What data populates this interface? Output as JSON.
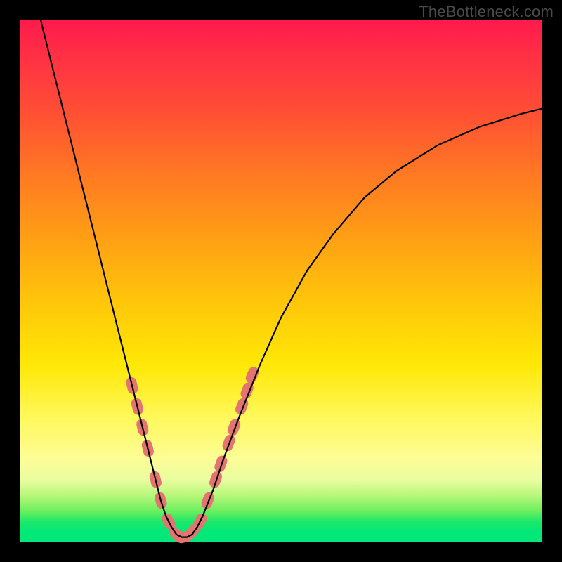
{
  "watermark": "TheBottleneck.com",
  "colors": {
    "frame": "#000000",
    "curve": "#000000",
    "bead": "#e4746f",
    "gradient_stops": [
      "#ff1a4d",
      "#ff3044",
      "#ff5034",
      "#ff7a22",
      "#ffa014",
      "#ffc60a",
      "#ffe805",
      "#fff85a",
      "#fdfd96",
      "#eafda0",
      "#b8f77a",
      "#6cef5e",
      "#1fe86a",
      "#00e878"
    ]
  },
  "chart_data": {
    "type": "line",
    "title": "",
    "xlabel": "",
    "ylabel": "",
    "xlim": [
      0,
      100
    ],
    "ylim": [
      0,
      100
    ],
    "series": [
      {
        "name": "bottleneck-curve",
        "x": [
          4,
          6,
          8,
          10,
          12,
          14,
          16,
          18,
          20,
          22,
          24,
          26,
          27,
          28,
          29,
          30,
          31,
          32,
          33,
          34,
          35,
          37,
          39,
          42,
          46,
          50,
          55,
          60,
          66,
          72,
          80,
          88,
          96,
          100
        ],
        "y": [
          100,
          92,
          84,
          76,
          68,
          60,
          52,
          44,
          36,
          28,
          20,
          12,
          8,
          5,
          3,
          1.5,
          1,
          1,
          1.5,
          3,
          5,
          10,
          16,
          24,
          34,
          43,
          52,
          59,
          66,
          71,
          76,
          79.5,
          82,
          83
        ]
      }
    ],
    "beads": {
      "comment": "Pink rounded segments overlaid on the curve near the valley",
      "points_xy": [
        [
          21.5,
          30
        ],
        [
          22.5,
          26
        ],
        [
          23.5,
          22
        ],
        [
          24.5,
          18
        ],
        [
          26,
          12
        ],
        [
          27,
          8
        ],
        [
          28.5,
          4
        ],
        [
          30,
          1.5
        ],
        [
          31.5,
          1
        ],
        [
          33,
          2
        ],
        [
          34.5,
          4
        ],
        [
          36,
          8
        ],
        [
          37.5,
          12
        ],
        [
          38.5,
          15
        ],
        [
          40,
          19
        ],
        [
          41,
          22
        ],
        [
          42.5,
          26
        ],
        [
          43.5,
          29
        ],
        [
          44.5,
          32
        ]
      ],
      "radius": 10
    }
  }
}
